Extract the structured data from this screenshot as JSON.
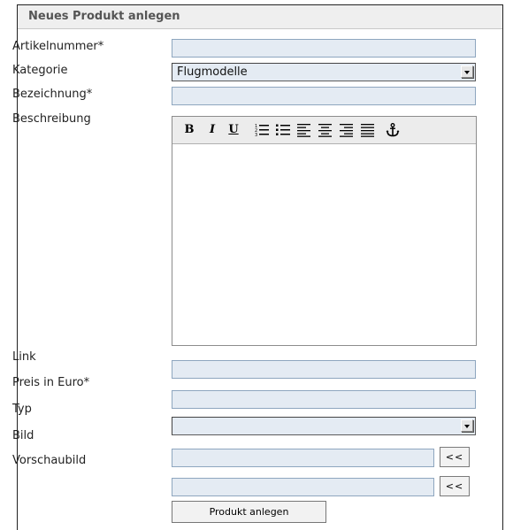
{
  "form": {
    "title": "Neues Produkt anlegen",
    "labels": {
      "article_number": "Artikelnummer*",
      "category": "Kategorie",
      "name": "Bezeichnung*",
      "description": "Beschreibung",
      "link": "Link",
      "price": "Preis in Euro*",
      "type": "Typ",
      "image": "Bild",
      "thumbnail": "Vorschaubild"
    },
    "values": {
      "article_number": "",
      "category": "Flugmodelle",
      "name": "",
      "description": "",
      "link": "",
      "price": "",
      "type": "",
      "image": "",
      "thumbnail": ""
    },
    "editor_toolbar": {
      "bold": "B",
      "italic": "I",
      "underline": "U",
      "icons": [
        "ordered-list-icon",
        "unordered-list-icon",
        "align-left-icon",
        "align-center-icon",
        "align-right-icon",
        "align-justify-icon",
        "anchor-icon"
      ]
    },
    "browse_button_label": "<<",
    "submit_label": "Produkt anlegen"
  }
}
